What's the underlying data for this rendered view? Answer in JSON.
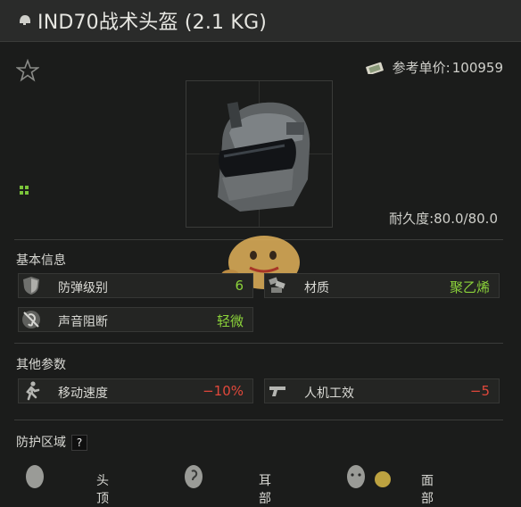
{
  "window": {
    "title": "IND70战术头盔 (2.1 KG)"
  },
  "header": {
    "price_label": "参考单价:",
    "price_value": "100959"
  },
  "durability": {
    "label": "耐久度:",
    "value": "80.0/80.0"
  },
  "sections": {
    "basic": "基本信息",
    "other": "其他参数",
    "protection": "防护区域"
  },
  "basic_stats": [
    {
      "label": "防弹级别",
      "value": "6",
      "icon": "shield-icon",
      "color": "#8bd23a"
    },
    {
      "label": "材质",
      "value": "聚乙烯",
      "icon": "material-icon",
      "color": "#8bd23a"
    },
    {
      "label": "声音阻断",
      "value": "轻微",
      "icon": "ear-muted-icon",
      "color": "#8bd23a"
    }
  ],
  "other_stats": [
    {
      "label": "移动速度",
      "value": "−10%",
      "icon": "running-icon",
      "color": "#e0483b"
    },
    {
      "label": "人机工效",
      "value": "−5",
      "icon": "pistol-icon",
      "color": "#e0483b"
    }
  ],
  "help_icon": "?",
  "zones": [
    {
      "label": "头顶",
      "icon": "head-top-icon"
    },
    {
      "label": "耳部",
      "icon": "ear-icon"
    },
    {
      "label": "面部",
      "icon": "face-icon"
    }
  ]
}
